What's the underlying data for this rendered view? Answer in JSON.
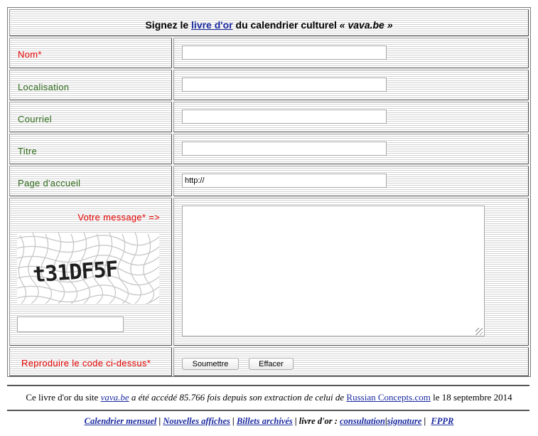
{
  "header": {
    "title_pre": "Signez le",
    "title_link": "livre d'or",
    "title_mid": "du calendrier culturel",
    "title_site": "« vava.be »"
  },
  "fields": {
    "nom": {
      "label": "Nom*",
      "value": ""
    },
    "localisation": {
      "label": "Localisation",
      "value": ""
    },
    "courriel": {
      "label": "Courriel",
      "value": ""
    },
    "titre": {
      "label": "Titre",
      "value": ""
    },
    "page_accueil": {
      "label": "Page d'accueil",
      "value": "http://"
    }
  },
  "message": {
    "label": "Votre message* =>",
    "value": ""
  },
  "captcha": {
    "code": "t31DF5F",
    "input_value": ""
  },
  "reproduce_label": "Reproduire le code ci-dessus*",
  "buttons": {
    "submit": "Soumettre",
    "reset": "Effacer"
  },
  "footer": {
    "p1": "Ce livre d'or du site",
    "site_link": "vava.be",
    "p2": "a été accédé 85.766 fois depuis son extraction de celui de",
    "rc_link": "Russian Concepts.com",
    "p3": "le 18 septembre 2014"
  },
  "nav": {
    "calendrier": "Calendrier mensuel",
    "sep1": "|",
    "affiches": "Nouvelles affiches",
    "sep2": "|",
    "billets": "Billets archivés",
    "sep3": "|",
    "livre": "livre d'or :",
    "consultation": "consultation",
    "sep4": "|",
    "signature": "signature",
    "sep5": "|",
    "fppr": "FPPR"
  }
}
